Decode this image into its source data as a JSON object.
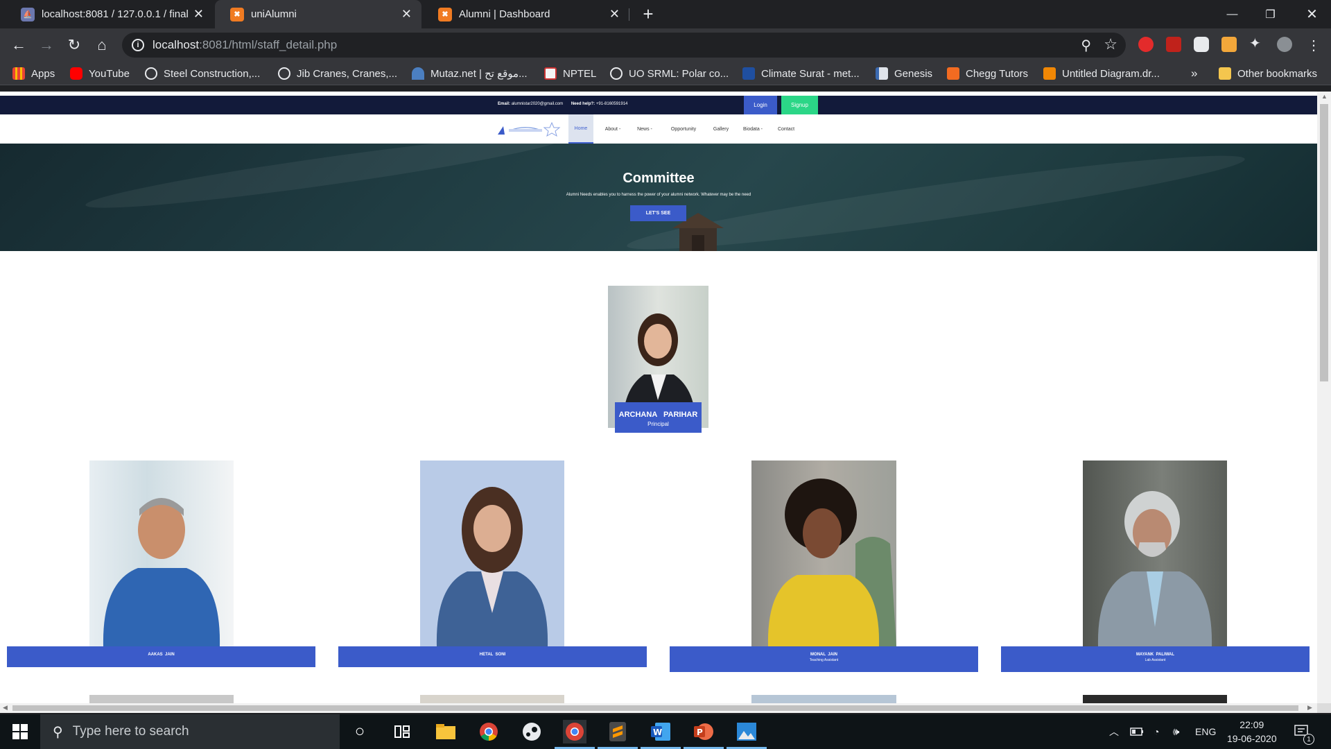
{
  "browser": {
    "tabs": [
      {
        "title": "localhost:8081 / 127.0.0.1 / final_",
        "icon": "phpmyadmin-icon",
        "active": false
      },
      {
        "title": "uniAlumni",
        "icon": "xampp-icon",
        "active": true
      },
      {
        "title": "Alumni | Dashboard",
        "icon": "xampp-icon",
        "active": false
      }
    ],
    "url_host": "localhost",
    "url_rest": ":8081/html/staff_detail.php",
    "bookmarks": [
      {
        "label": "Apps",
        "icon": "apps-grid-icon"
      },
      {
        "label": "YouTube",
        "icon": "youtube-icon"
      },
      {
        "label": "Steel Construction,...",
        "icon": "globe-icon"
      },
      {
        "label": "Jib Cranes, Cranes,...",
        "icon": "globe-icon"
      },
      {
        "label": "Mutaz.net | موقع تح...",
        "icon": "mutaz-icon"
      },
      {
        "label": "NPTEL",
        "icon": "nptel-icon"
      },
      {
        "label": "UO SRML: Polar co...",
        "icon": "globe-icon"
      },
      {
        "label": "Climate Surat - met...",
        "icon": "meteoblue-icon"
      },
      {
        "label": "Genesis",
        "icon": "genesis-icon"
      },
      {
        "label": "Chegg Tutors",
        "icon": "chegg-icon"
      },
      {
        "label": "Untitled Diagram.dr...",
        "icon": "drawio-icon"
      }
    ],
    "overflow_label": "»",
    "other_bookmarks": "Other bookmarks"
  },
  "site": {
    "email_label": "Email:",
    "email_value": "alumnistar2020@gmail.com",
    "help_label": "Need help?:",
    "help_value": "+91-8160591914",
    "login_label": "Login",
    "signup_label": "Signup",
    "nav": [
      {
        "label": "Home",
        "active": true
      },
      {
        "label": "About -",
        "active": false
      },
      {
        "label": "News -",
        "active": false
      },
      {
        "label": "Opportunity",
        "active": false
      },
      {
        "label": "Gallery",
        "active": false
      },
      {
        "label": "Biodata -",
        "active": false
      },
      {
        "label": "Contact",
        "active": false
      }
    ],
    "hero": {
      "title": "Committee",
      "subtitle": "Alumni Needs enables you to harness the power of your alumni network. Whatever may be the need",
      "cta": "LET'S SEE"
    },
    "principal": {
      "name": "ARCHANA   PARIHAR",
      "role": "Principal"
    },
    "staff": [
      {
        "name": "AAKAS  JAIN",
        "role": ""
      },
      {
        "name": "HETAL  SONI",
        "role": ""
      },
      {
        "name": "MONAL  JAIN",
        "role": "Teaching Assistant"
      },
      {
        "name": "MAYANK  PALIWAL",
        "role": "Lab Assistant"
      }
    ]
  },
  "taskbar": {
    "search_placeholder": "Type here to search",
    "language": "ENG",
    "time": "22:09",
    "date": "19-06-2020",
    "notification_count": "1"
  }
}
